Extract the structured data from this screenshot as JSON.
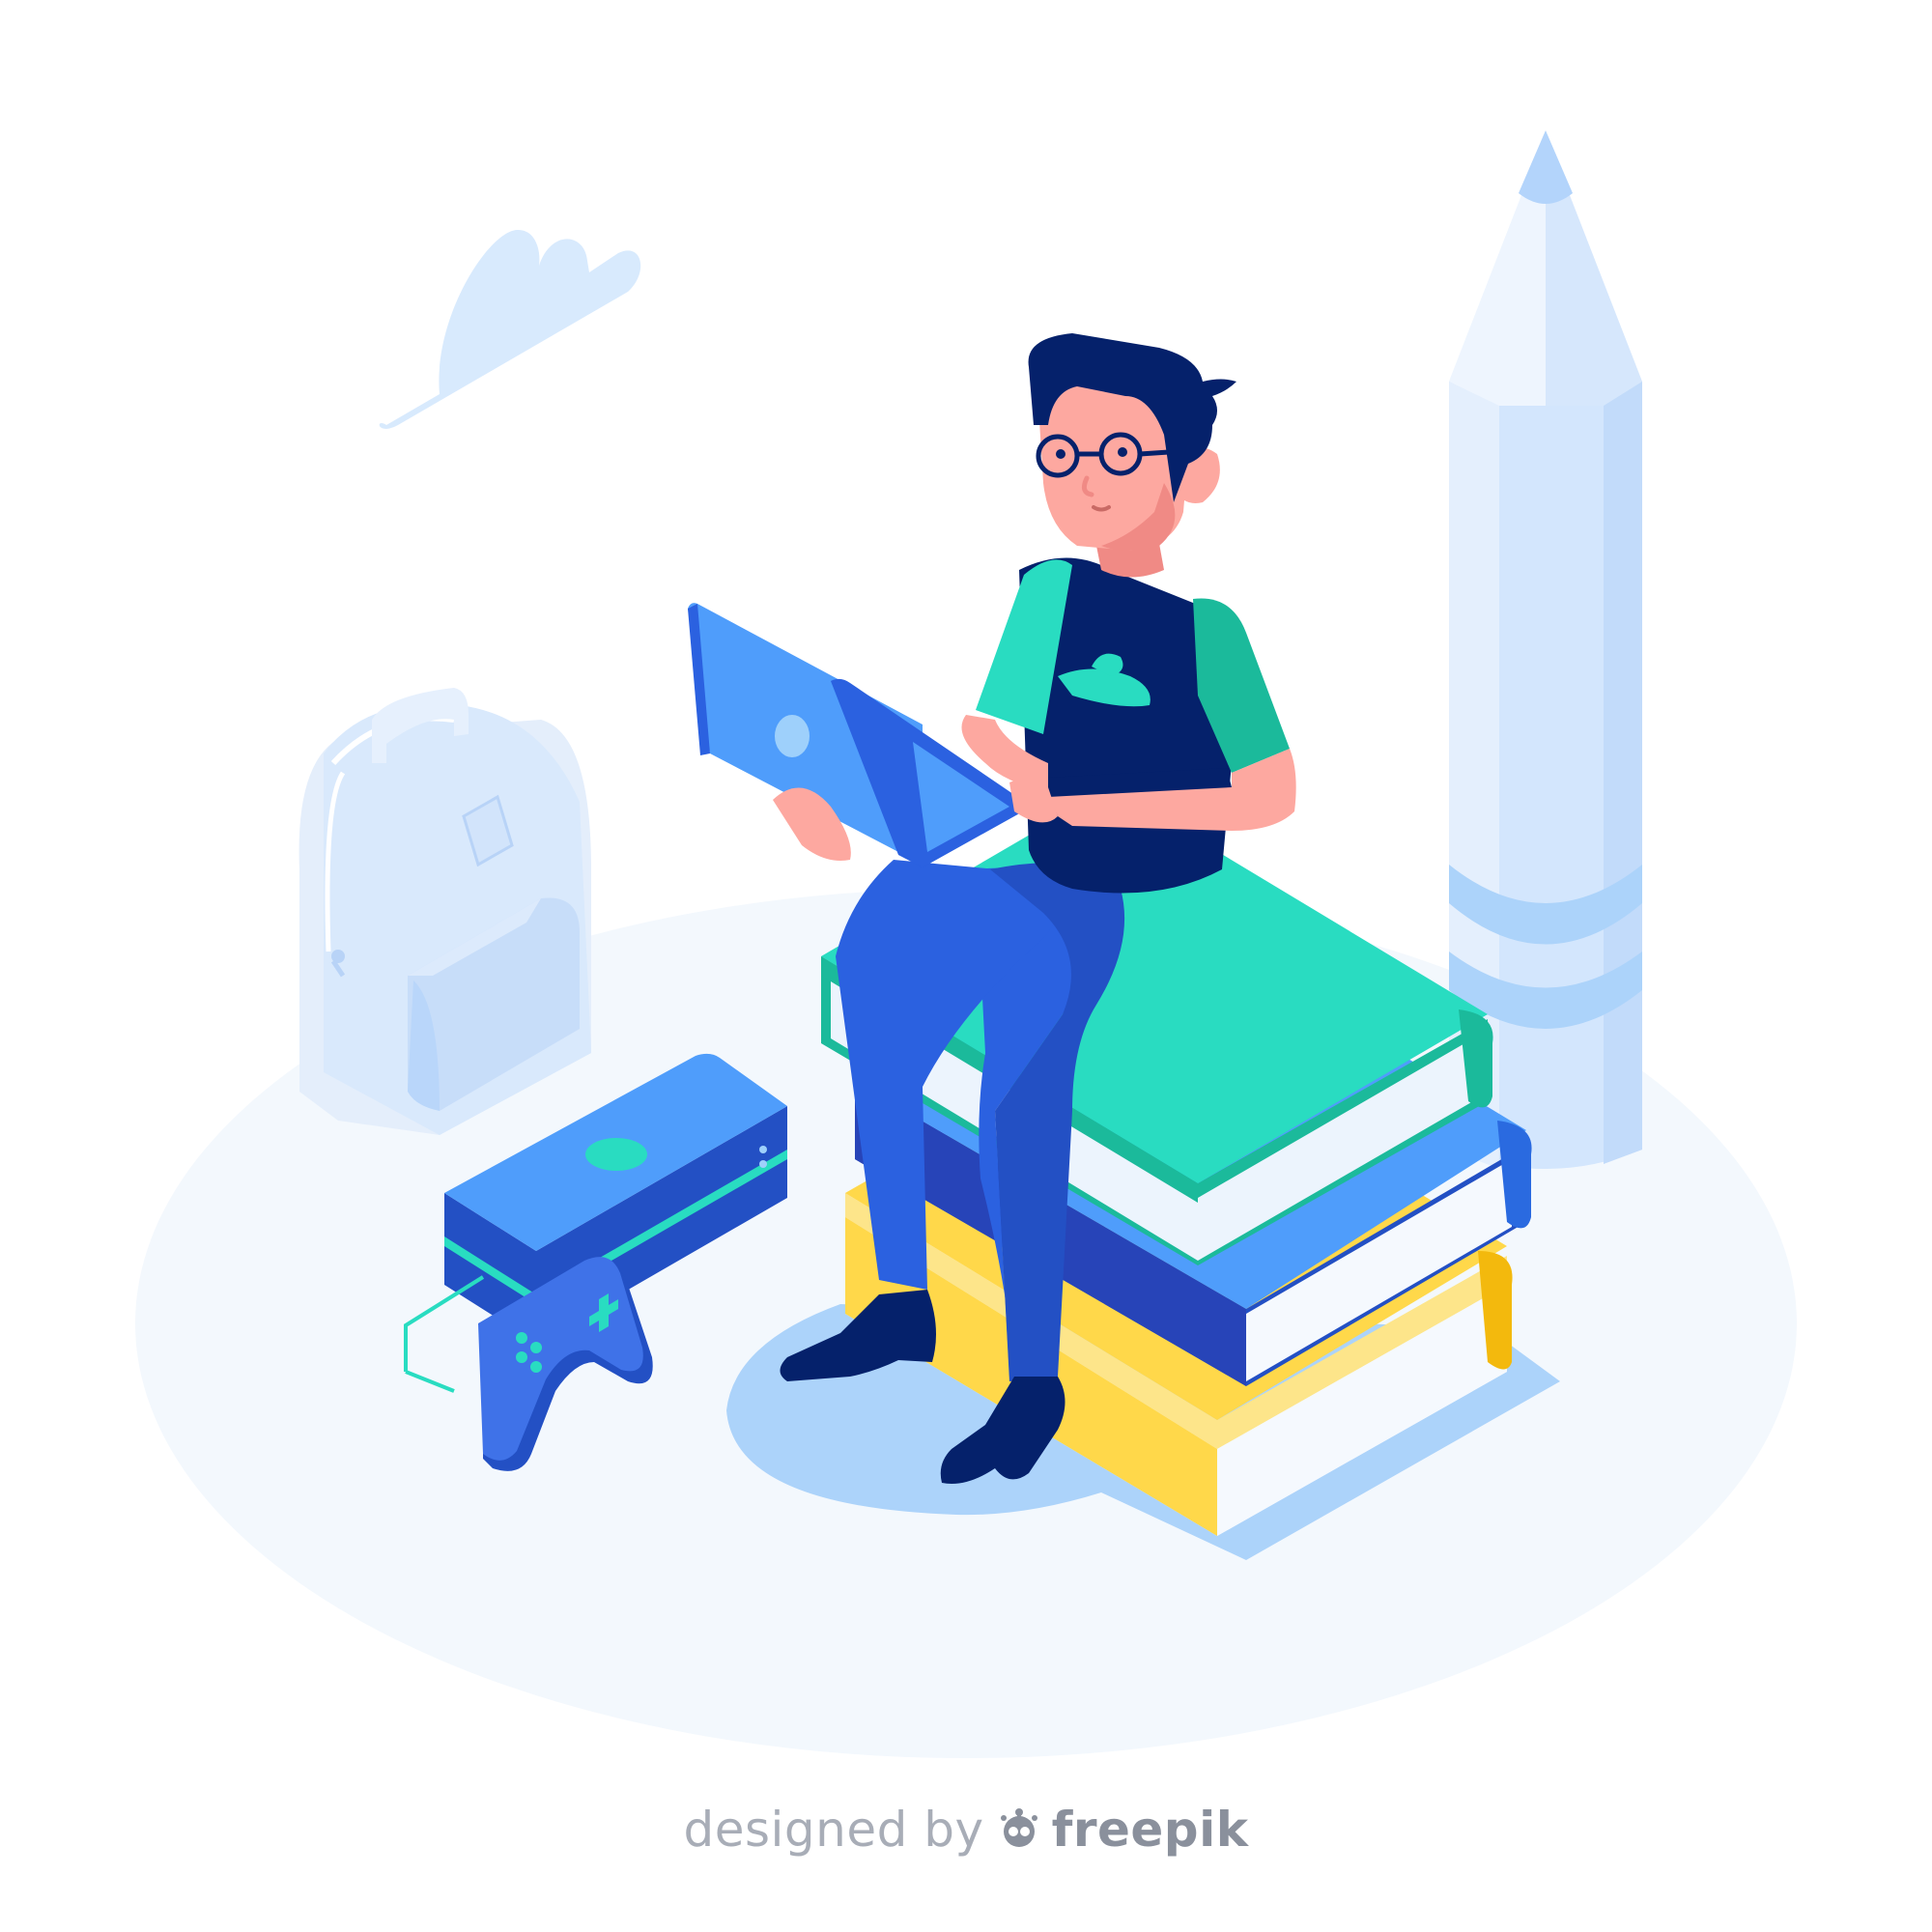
{
  "credit": {
    "designed_by": "designed by",
    "brand": "freepik"
  },
  "illustration": {
    "subject": "person-sitting-on-books-with-laptop",
    "icons": [
      "cloud-icon",
      "pencil-icon",
      "backpack-icon",
      "game-console-icon",
      "gamepad-icon",
      "laptop-icon",
      "book-stack-icon"
    ]
  },
  "colors": {
    "background": "#ffffff",
    "floor": "#f3f8fd",
    "shadow": "#acd3fa",
    "light_blue": "#d8eafd",
    "pale_blue": "#c3dcf8",
    "teal": "#29dcc1",
    "teal_dark": "#1bba9b",
    "blue": "#4f9dfb",
    "blue_dark": "#2350c4",
    "navy": "#05216b",
    "yellow": "#ffd84a",
    "yellow_dark": "#f3b90d",
    "skin": "#fda8a0",
    "skin_dark": "#f08a85",
    "text_grey": "#a8adb7"
  }
}
